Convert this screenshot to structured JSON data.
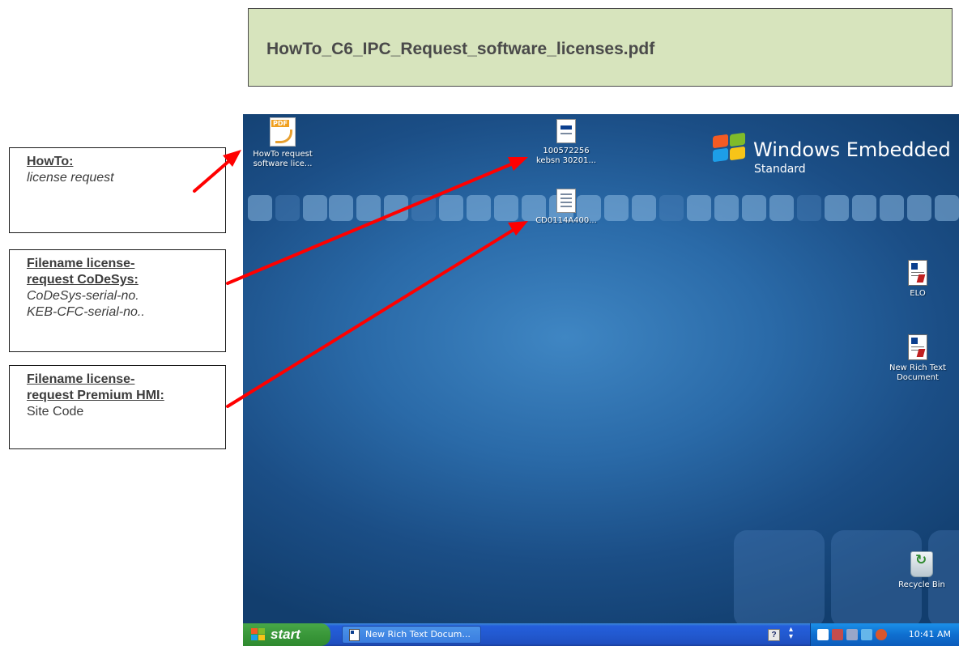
{
  "doc_title": "HowTo_C6_IPC_Request_software_licenses.pdf",
  "notes": [
    {
      "heading": "HowTo:",
      "lines": [
        "license request"
      ],
      "italic": true
    },
    {
      "heading_lines": [
        "Filename license-",
        "request CoDeSys:"
      ],
      "lines": [
        "CoDeSys-serial-no.",
        "KEB-CFC-serial-no.."
      ],
      "italic": true
    },
    {
      "heading_lines": [
        "Filename license-",
        "request Premium HMI:"
      ],
      "lines": [
        "Site Code"
      ],
      "italic": false
    }
  ],
  "desktop": {
    "logo": {
      "line1": "Windows Embedded",
      "line2": "Standard"
    },
    "icons": {
      "howto_pdf": {
        "line1": "HowTo request",
        "line2": "software lice...",
        "icon": "pdf-icon"
      },
      "kebsn_file": {
        "line1": "100572256",
        "line2": "kebsn 30201...",
        "icon": "file-icon"
      },
      "cd_file": {
        "line1": "CD0114A400...",
        "icon": "text-file-icon"
      },
      "elo": {
        "line1": "ELO",
        "icon": "rtf-document-icon"
      },
      "new_rtf": {
        "line1": "New Rich Text",
        "line2": "Document",
        "icon": "rtf-document-icon"
      },
      "recycle_bin": {
        "line1": "Recycle Bin",
        "icon": "recycle-bin-icon"
      }
    }
  },
  "taskbar": {
    "start_label": "start",
    "task_item": "New Rich Text Docum...",
    "help_icon": "?",
    "clock": "10:41 AM"
  },
  "colors": {
    "arrow": "#ff0000",
    "title_bg": "#d7e4bd",
    "desktop": "#2a6aa8",
    "taskbar": "#245edb",
    "start": "#3c9a3c"
  }
}
